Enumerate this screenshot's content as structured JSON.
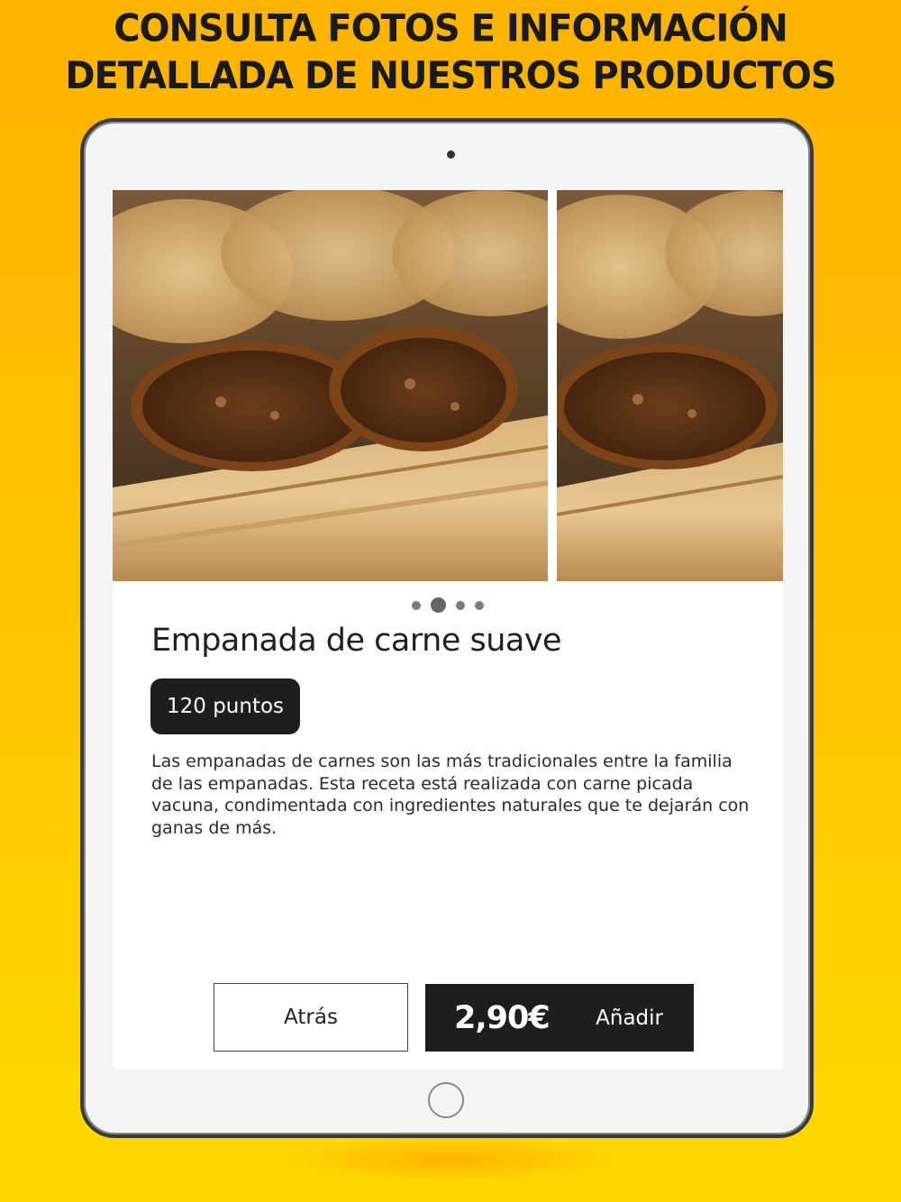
{
  "headline": {
    "line1": "CONSULTA FOTOS E INFORMACIÓN",
    "line2": "DETALLADA DE NUESTROS PRODUCTOS"
  },
  "product": {
    "name": "Empanada de carne suave",
    "points": "120 puntos",
    "description": "Las empanadas de carnes son las más tradicionales entre la familia de las empanadas. Esta receta está realizada con carne picada vacuna, condimentada con ingredientes naturales que te dejarán con ganas de más.",
    "price": "2,90€"
  },
  "gallery": {
    "total_images": 4,
    "active_index": 1
  },
  "actions": {
    "back_label": "Atrás",
    "add_label": "Añadir"
  },
  "colors": {
    "background_top": "#ffb300",
    "background_bottom": "#ffd800",
    "button_dark": "#1e1e1e"
  }
}
